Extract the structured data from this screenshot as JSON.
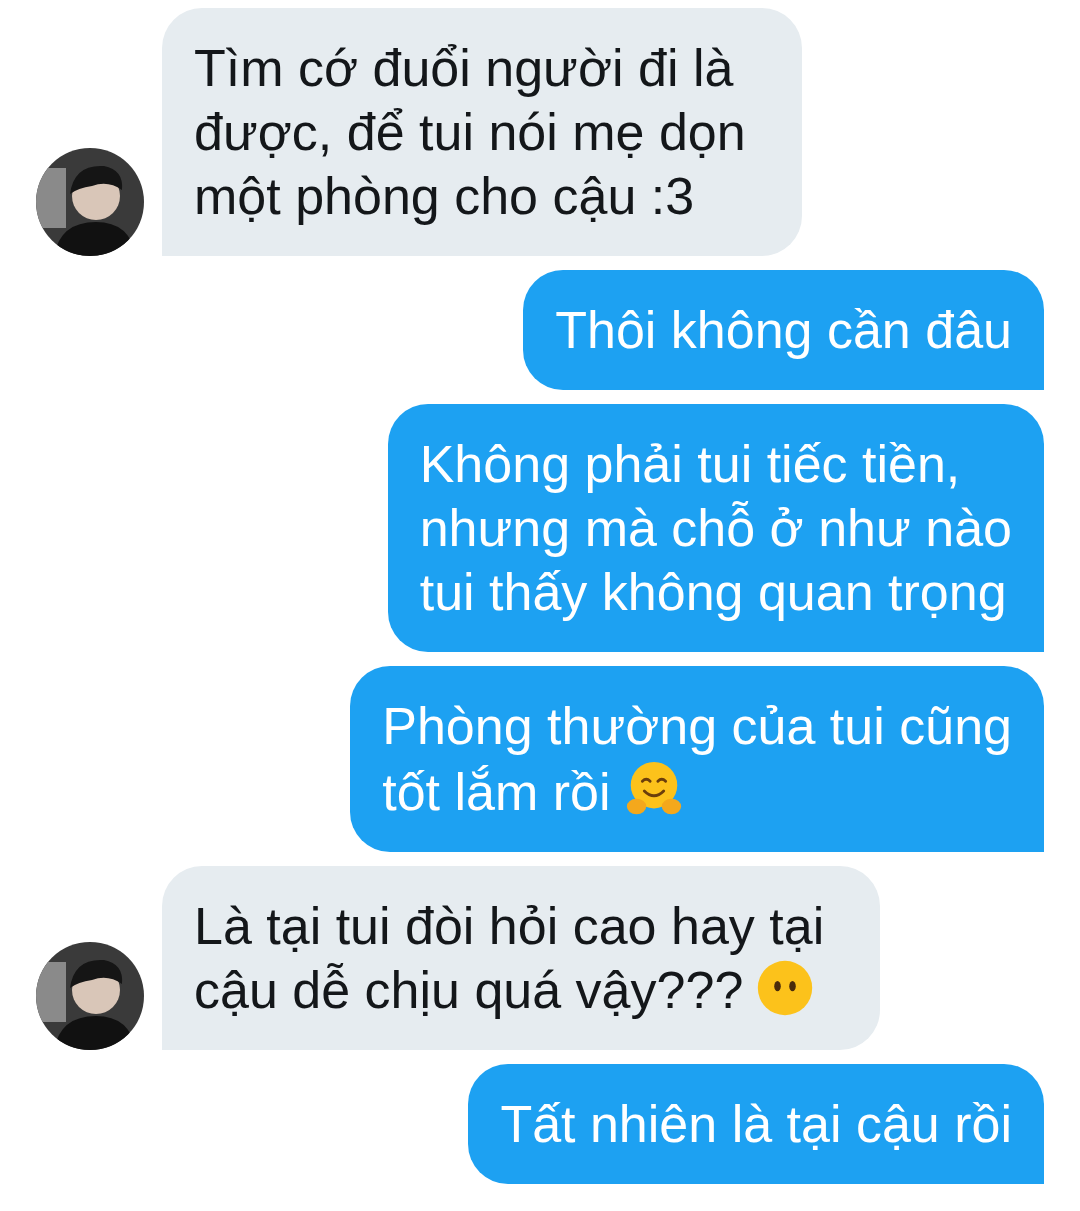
{
  "messages": [
    {
      "kind": "incoming",
      "avatar": true,
      "lines": [
        "Tìm cớ đuổi người đi là",
        "được, để tui nói mẹ dọn",
        "một phòng cho cậu :3"
      ]
    },
    {
      "kind": "outgoing",
      "lines": [
        "Thôi không cần đâu"
      ]
    },
    {
      "kind": "outgoing",
      "lines": [
        "Không phải tui tiếc tiền,",
        "nhưng mà chỗ ở như nào",
        "tui thấy không quan trọng"
      ]
    },
    {
      "kind": "outgoing",
      "lines": [
        "Phòng thường của tui cũng",
        "tốt lắm rồi"
      ],
      "trailing_icon": {
        "kind": "hug"
      }
    },
    {
      "kind": "incoming",
      "avatar": true,
      "lines": [
        "Là tại tui đòi hỏi cao hay tại",
        "cậu dễ chịu quá vậy???"
      ],
      "trailing_icon": {
        "kind": "blank"
      }
    },
    {
      "kind": "outgoing",
      "lines": [
        "Tất nhiên là tại cậu rồi"
      ]
    }
  ]
}
